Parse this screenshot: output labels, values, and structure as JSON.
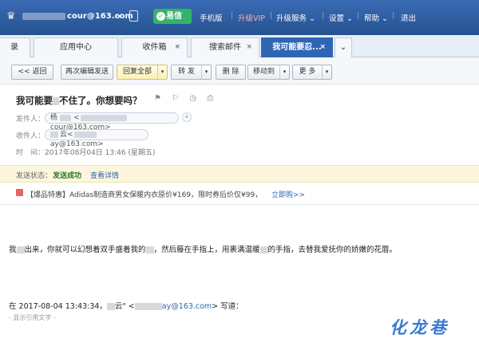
{
  "topbar": {
    "email_suffix": "cour@163.com",
    "yixin_label": "易信",
    "links": [
      "手机版",
      "升级VIP",
      "升级服务 ⌄",
      "设置 ⌄",
      "帮助 ⌄",
      "退出"
    ],
    "separators": [
      "|",
      "|",
      "|",
      "|",
      "|",
      "|"
    ]
  },
  "tabs": {
    "items": [
      {
        "label": "录"
      },
      {
        "label": "应用中心"
      },
      {
        "label": "收件箱"
      },
      {
        "label": "搜索邮件"
      },
      {
        "label": "我可能要忍..."
      }
    ],
    "close_glyph": "×",
    "more_glyph": "⌄"
  },
  "toolbar": {
    "back": "<< 返回",
    "reedit": "再次编辑发送",
    "reply_all": "回复全部",
    "forward": "转 发",
    "delete": "删 除",
    "move": "移动到",
    "more": "更 多",
    "arrow": "▾"
  },
  "mail": {
    "subject_a": "我可能要",
    "subject_b": "不住了。你想要吗？",
    "subject_icons": "⚑ ⚐ ◷ ⎙",
    "from_label": "发件人：",
    "from_name": "杨",
    "from_email": "cour@163.com>",
    "to_label": "收件人：",
    "to_name": "云<",
    "to_email": "ay@163.com>",
    "time_label": "时　间：",
    "time_value": "2017年08月04日 13:46 (星期五)",
    "plus_glyph": "+"
  },
  "status": {
    "label": "发送状态：",
    "value": "发送成功",
    "detail": "查看详情"
  },
  "ad": {
    "text": "【爆品特惠】Adidas制造商男女保暖内衣原价¥169，限时券后价仅¥99，",
    "buy": "立即购>>"
  },
  "body": {
    "p1": "我",
    "p2": "出来，你就可以幻想着双手盛着我的",
    "p3": "，然后藤在手指上，用裹满温暖",
    "p4": "的手指，去替我爱抚你的娇嫩的花唇。"
  },
  "quote": {
    "prefix": "在 2017-08-04 13:43:34，",
    "name": "云\" <",
    "addr": "ay@163.com",
    "suffix": "> 写道：",
    "show": "- 显示引用文字 -"
  },
  "watermark": "化龙巷",
  "colors": {
    "topbar": "#2c5aa0",
    "accent": "#2f66b3",
    "yixin": "#34b36a",
    "status_bg": "#fbf6dd",
    "success": "#2a7a2a"
  }
}
